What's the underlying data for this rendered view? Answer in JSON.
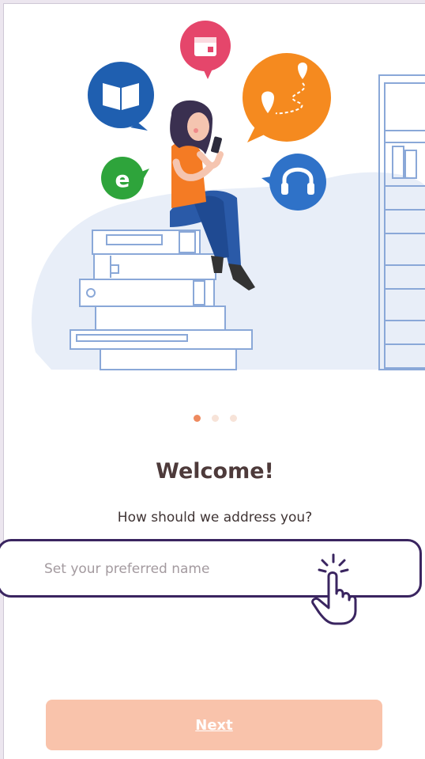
{
  "onboarding": {
    "title": "Welcome!",
    "prompt": "How should we address you?",
    "name_input": {
      "value": "",
      "placeholder": "Set your preferred name"
    },
    "next_label": "Next",
    "pagination": {
      "total": 3,
      "active_index": 0
    },
    "illustration_icons": [
      "book-icon",
      "calendar-icon",
      "map-route-icon",
      "e-learning-icon",
      "headphones-icon"
    ]
  },
  "colors": {
    "accent": "#ee8a5f",
    "next_button_bg": "#f9c3ab",
    "title_text": "#4d3a3a",
    "highlight_border": "#3a2560",
    "blob_bg": "#e8eef8"
  }
}
